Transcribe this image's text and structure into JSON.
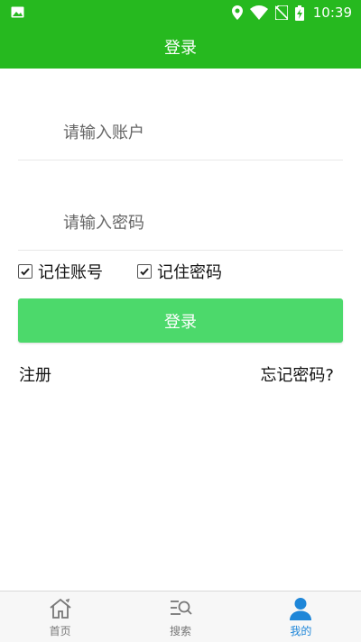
{
  "status_bar": {
    "time": "10:39"
  },
  "title": "登录",
  "form": {
    "account_placeholder": "请输入账户",
    "password_placeholder": "请输入密码",
    "remember_account_label": "记住账号",
    "remember_password_label": "记住密码",
    "login_button_label": "登录",
    "register_label": "注册",
    "forgot_password_label": "忘记密码?"
  },
  "tabs": [
    {
      "label": "首页",
      "icon": "home-icon",
      "active": false
    },
    {
      "label": "搜索",
      "icon": "search-icon",
      "active": false
    },
    {
      "label": "我的",
      "icon": "user-icon",
      "active": true
    }
  ],
  "colors": {
    "header": "#26b91f",
    "button": "#4cd96b",
    "active_tab": "#1e86d8"
  }
}
